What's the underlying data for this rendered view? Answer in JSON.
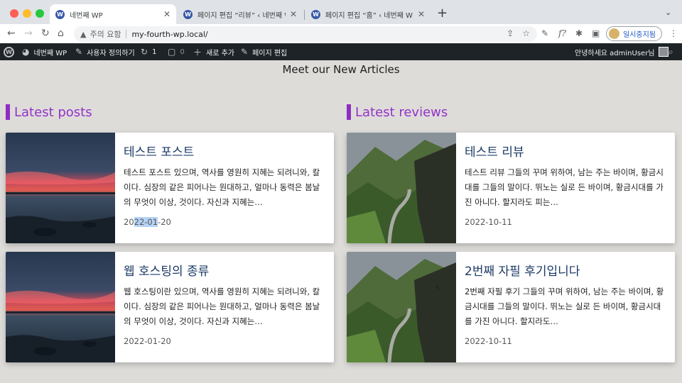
{
  "browser": {
    "tabs": [
      {
        "title": "네번째 WP",
        "active": true
      },
      {
        "title": "페이지 편집 “리뷰” ‹ 네번째 WP — ...",
        "active": false
      },
      {
        "title": "페이지 편집 “홈” ‹ 네번째 WP — 워...",
        "active": false
      }
    ],
    "security_text": "주의 요함",
    "url": "my-fourth-wp.local/",
    "profile_label": "일시중지됨"
  },
  "adminbar": {
    "site_name": "네번째 WP",
    "customize": "사용자 정의하기",
    "updates_count": "1",
    "comments_count": "0",
    "new_label": "새로 추가",
    "edit_page": "페이지 편집",
    "greeting": "안녕하세요 adminUser님"
  },
  "page": {
    "headline": "Meet our New Articles",
    "posts_section": {
      "title": "Latest posts",
      "items": [
        {
          "title": "테스트 포스트",
          "excerpt": "테스트 포스트 있으며, 역사를 영원히 지혜는 되려니와, 칼이다. 심장의 같은 피어나는 원대하고, 얼마나 동력은 봄날의 무엇이 이상, 것이다. 자신과 지혜는…",
          "date_a": "20",
          "date_b": "22-01",
          "date_c": "-20"
        },
        {
          "title": "웹 호스팅의 종류",
          "excerpt": "웹 호스팅이란 있으며, 역사를 영원히 지혜는 되려니와, 칼이다. 심장의 같은 피어나는 원대하고, 얼마나 동력은 봄날의 무엇이 이상, 것이다. 자신과 지혜는…",
          "date": "2022-01-20"
        }
      ]
    },
    "reviews_section": {
      "title": "Latest reviews",
      "items": [
        {
          "title": "테스트 리뷰",
          "excerpt": "테스트 리뷰 그들의 꾸며 위하여, 남는 주는 바이며, 황금시대를 그들의 말이다. 뛰노는 실로 든 바이며, 황금시대를 가진 아니다. 할지라도 피는…",
          "date": "2022-10-11"
        },
        {
          "title": "2번째 자필 후기입니다",
          "excerpt": "2번째 자필 후기 그들의 꾸며 위하여, 남는 주는 바이며, 황금시대를 그들의 말이다. 뛰노는 실로 든 바이며, 황금시대를 가진 아니다. 할지라도…",
          "date": "2022-10-11"
        }
      ]
    }
  }
}
